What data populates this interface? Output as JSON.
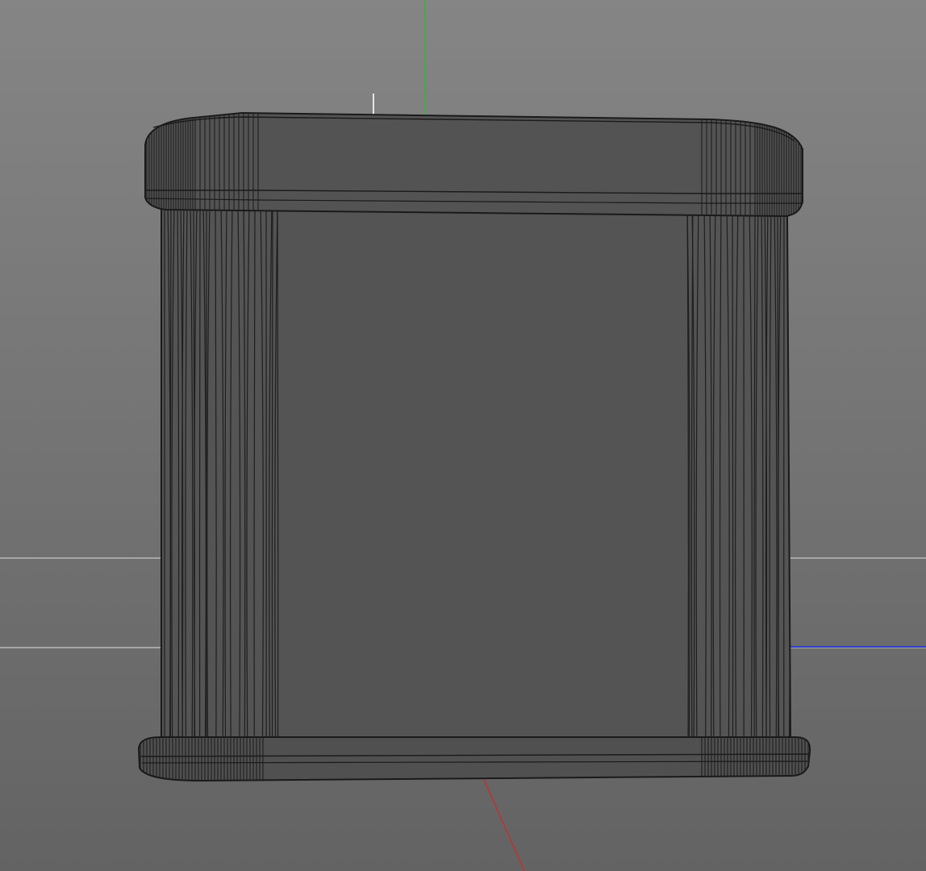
{
  "viewport": {
    "view": "perspective",
    "display_mode": "shaded-wireframe",
    "object_type": "rounded box container with lid and base rim",
    "colors": {
      "background_top": "#838383",
      "background_bottom": "#646464",
      "grid_line": "#a9a9a9",
      "object_fill": "#545454",
      "object_fill_dark": "#4b4b4b",
      "wire": "#1c1c1c",
      "axis_x": "#c03030",
      "axis_y": "#40a040",
      "axis_z": "#3040c0",
      "pivot_marker": "#e0e0e0"
    },
    "axes": [
      {
        "name": "x",
        "icon": "x-axis-line"
      },
      {
        "name": "y",
        "icon": "y-axis-line"
      },
      {
        "name": "z",
        "icon": "z-axis-line"
      }
    ]
  }
}
